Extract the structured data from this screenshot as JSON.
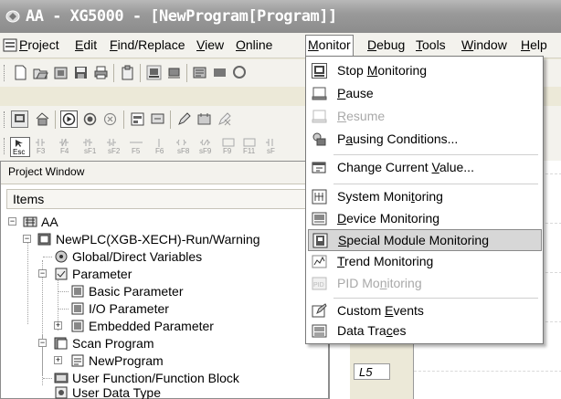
{
  "window": {
    "title": "AA - XG5000 - [NewProgram[Program]]"
  },
  "menubar": {
    "items": [
      {
        "pre": "",
        "ul": "P",
        "post": "roject"
      },
      {
        "pre": "",
        "ul": "E",
        "post": "dit"
      },
      {
        "pre": "",
        "ul": "F",
        "post": "ind/Replace"
      },
      {
        "pre": "",
        "ul": "V",
        "post": "iew"
      },
      {
        "pre": "",
        "ul": "O",
        "post": "nline"
      },
      {
        "pre": "",
        "ul": "M",
        "post": "onitor"
      },
      {
        "pre": "",
        "ul": "D",
        "post": "ebug"
      },
      {
        "pre": "",
        "ul": "T",
        "post": "ools"
      },
      {
        "pre": "",
        "ul": "W",
        "post": "indow"
      },
      {
        "pre": "",
        "ul": "H",
        "post": "elp"
      }
    ]
  },
  "toolbar3": {
    "fkeys": [
      "Esc",
      "F3",
      "F4",
      "sF1",
      "sF2",
      "F5",
      "F6",
      "sF8",
      "sF9",
      "F9",
      "F11",
      "sF"
    ]
  },
  "project_window": {
    "title": "Project Window",
    "items_header": "Items",
    "tree": [
      {
        "label": "AA",
        "icon": "project-icon"
      },
      {
        "label": "NewPLC(XGB-XECH)-Run/Warning",
        "icon": "plc-icon"
      },
      {
        "label": "Global/Direct Variables",
        "icon": "variables-icon"
      },
      {
        "label": "Parameter",
        "icon": "parameter-icon"
      },
      {
        "label": "Basic Parameter",
        "icon": "parameter-doc-icon"
      },
      {
        "label": "I/O Parameter",
        "icon": "parameter-doc-icon"
      },
      {
        "label": "Embedded Parameter",
        "icon": "parameter-doc-icon"
      },
      {
        "label": "Scan Program",
        "icon": "scan-program-icon"
      },
      {
        "label": "NewProgram",
        "icon": "program-icon"
      },
      {
        "label": "User Function/Function Block",
        "icon": "function-block-icon"
      },
      {
        "label": "User Data Type",
        "icon": "data-type-icon"
      }
    ]
  },
  "editor": {
    "rung_label": "L5"
  },
  "monitor_menu": {
    "items": [
      {
        "pre": "Stop ",
        "ul": "M",
        "post": "onitoring",
        "icon": "stop-monitoring-icon",
        "enabled": true
      },
      {
        "pre": "",
        "ul": "P",
        "post": "ause",
        "icon": "pause-icon",
        "enabled": true
      },
      {
        "pre": "",
        "ul": "R",
        "post": "esume",
        "icon": "resume-icon",
        "enabled": false
      },
      {
        "pre": "P",
        "ul": "a",
        "post": "using Conditions...",
        "icon": "pausing-conditions-icon",
        "enabled": true
      },
      {
        "pre": "Change Current ",
        "ul": "V",
        "post": "alue...",
        "icon": "change-value-icon",
        "enabled": true
      },
      {
        "pre": "System Moni",
        "ul": "t",
        "post": "oring",
        "icon": "system-monitoring-icon",
        "enabled": true
      },
      {
        "pre": "",
        "ul": "D",
        "post": "evice Monitoring",
        "icon": "device-monitoring-icon",
        "enabled": true
      },
      {
        "pre": "",
        "ul": "S",
        "post": "pecial Module Monitoring",
        "icon": "special-module-icon",
        "enabled": true,
        "highlighted": true
      },
      {
        "pre": "",
        "ul": "T",
        "post": "rend Monitoring",
        "icon": "trend-monitoring-icon",
        "enabled": true
      },
      {
        "pre": "PID Mo",
        "ul": "n",
        "post": "itoring",
        "icon": "pid-monitoring-icon",
        "enabled": false
      },
      {
        "pre": "Custom ",
        "ul": "E",
        "post": "vents",
        "icon": "custom-events-icon",
        "enabled": true
      },
      {
        "pre": "Data Tra",
        "ul": "c",
        "post": "es",
        "icon": "data-traces-icon",
        "enabled": true
      }
    ]
  }
}
